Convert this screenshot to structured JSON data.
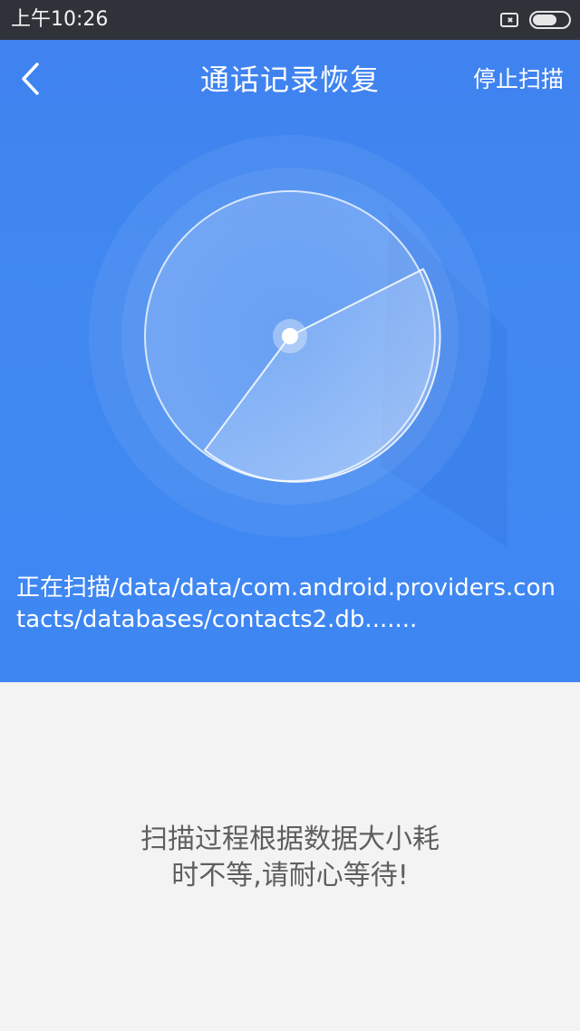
{
  "status_bar": {
    "time": "上午10:26"
  },
  "header": {
    "title": "通话记录恢复",
    "stop_label": "停止扫描",
    "back_icon": "chevron-left-icon"
  },
  "scan": {
    "path_text": "正在扫描/data/data/com.android.providers.contacts/databases/contacts2.db......."
  },
  "info": {
    "line1": "扫描过程根据数据大小耗",
    "line2": "时不等,请耐心等待!"
  },
  "colors": {
    "primary_blue": "#3f82f0",
    "status_bar": "#2f3238",
    "background": "#f3f3f3",
    "info_text": "#5f5f5f"
  }
}
